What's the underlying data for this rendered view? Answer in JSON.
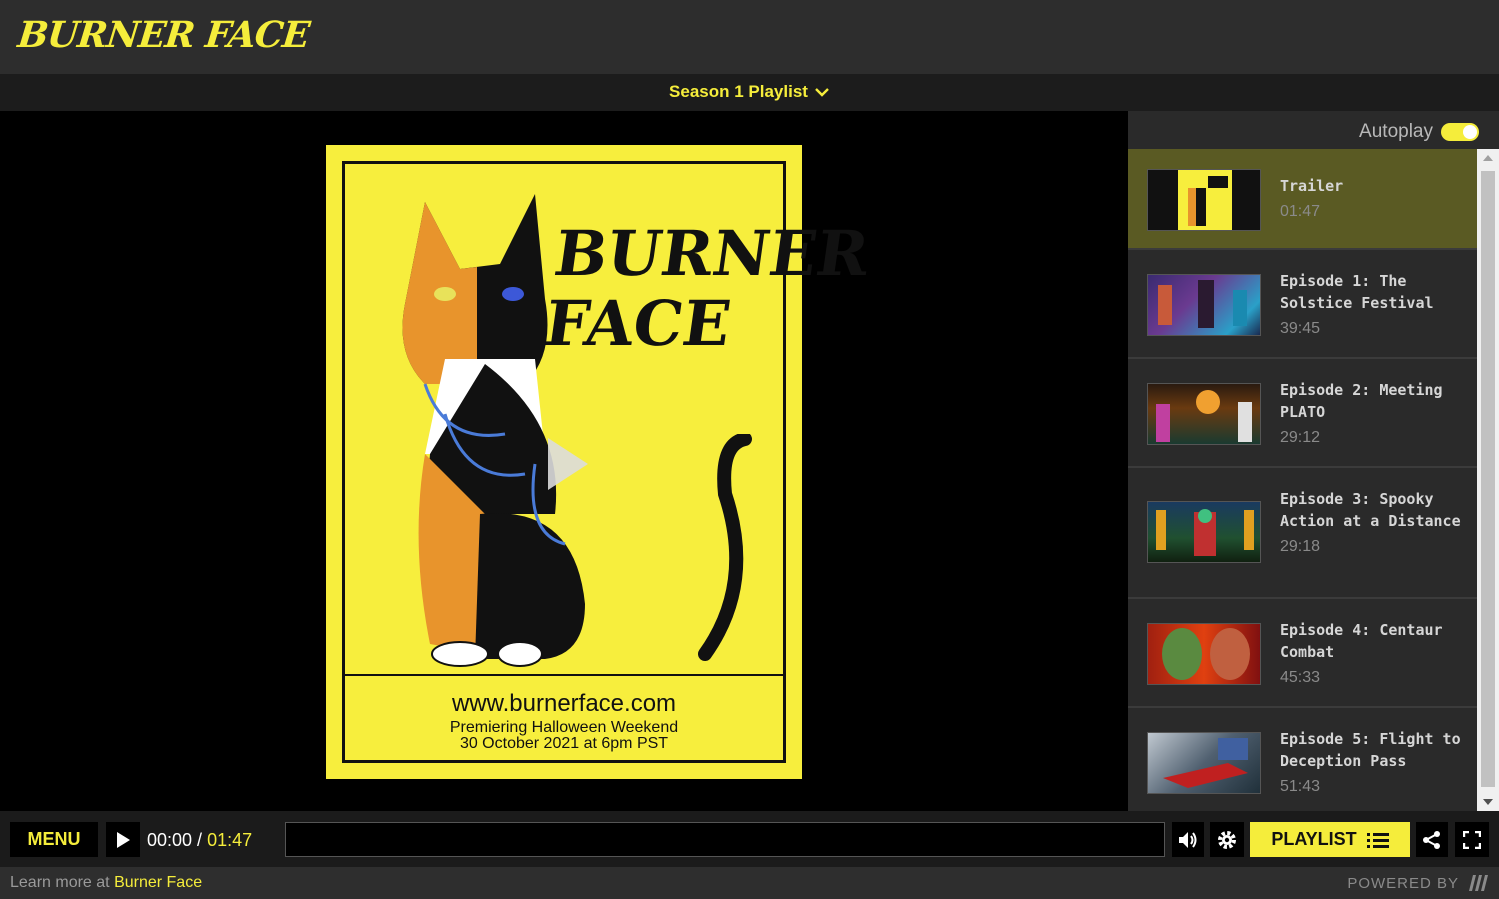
{
  "header": {
    "logo_text": "BURNER FACE"
  },
  "playlist_bar": {
    "title": "Season 1 Playlist"
  },
  "poster": {
    "title_line1": "BURNER",
    "title_line2": "FACE",
    "url": "www.burnerface.com",
    "line2": "Premiering Halloween Weekend",
    "line3": "30 October 2021 at 6pm PST"
  },
  "sidebar": {
    "autoplay_label": "Autoplay",
    "autoplay_on": true,
    "episodes": [
      {
        "title": "Trailer",
        "duration": "01:47",
        "active": true
      },
      {
        "title": "Episode 1: The Solstice Festival",
        "duration": "39:45"
      },
      {
        "title": "Episode 2: Meeting PLATO",
        "duration": "29:12"
      },
      {
        "title": "Episode 3: Spooky Action at a Distance",
        "duration": "29:18"
      },
      {
        "title": "Episode 4: Centaur Combat",
        "duration": "45:33"
      },
      {
        "title": "Episode 5: Flight to Deception Pass",
        "duration": "51:43"
      }
    ]
  },
  "controls": {
    "menu_label": "MENU",
    "time_current": "00:00",
    "time_separator": " / ",
    "time_total": "01:47",
    "playlist_label": "PLAYLIST",
    "progress": 0
  },
  "footer": {
    "learn_more_prefix": "Learn more at ",
    "learn_more_link": "Burner Face",
    "powered_by": "POWERED BY"
  },
  "colors": {
    "accent": "#f5ed3b",
    "active_row": "#5a5a23",
    "background": "#000000"
  }
}
